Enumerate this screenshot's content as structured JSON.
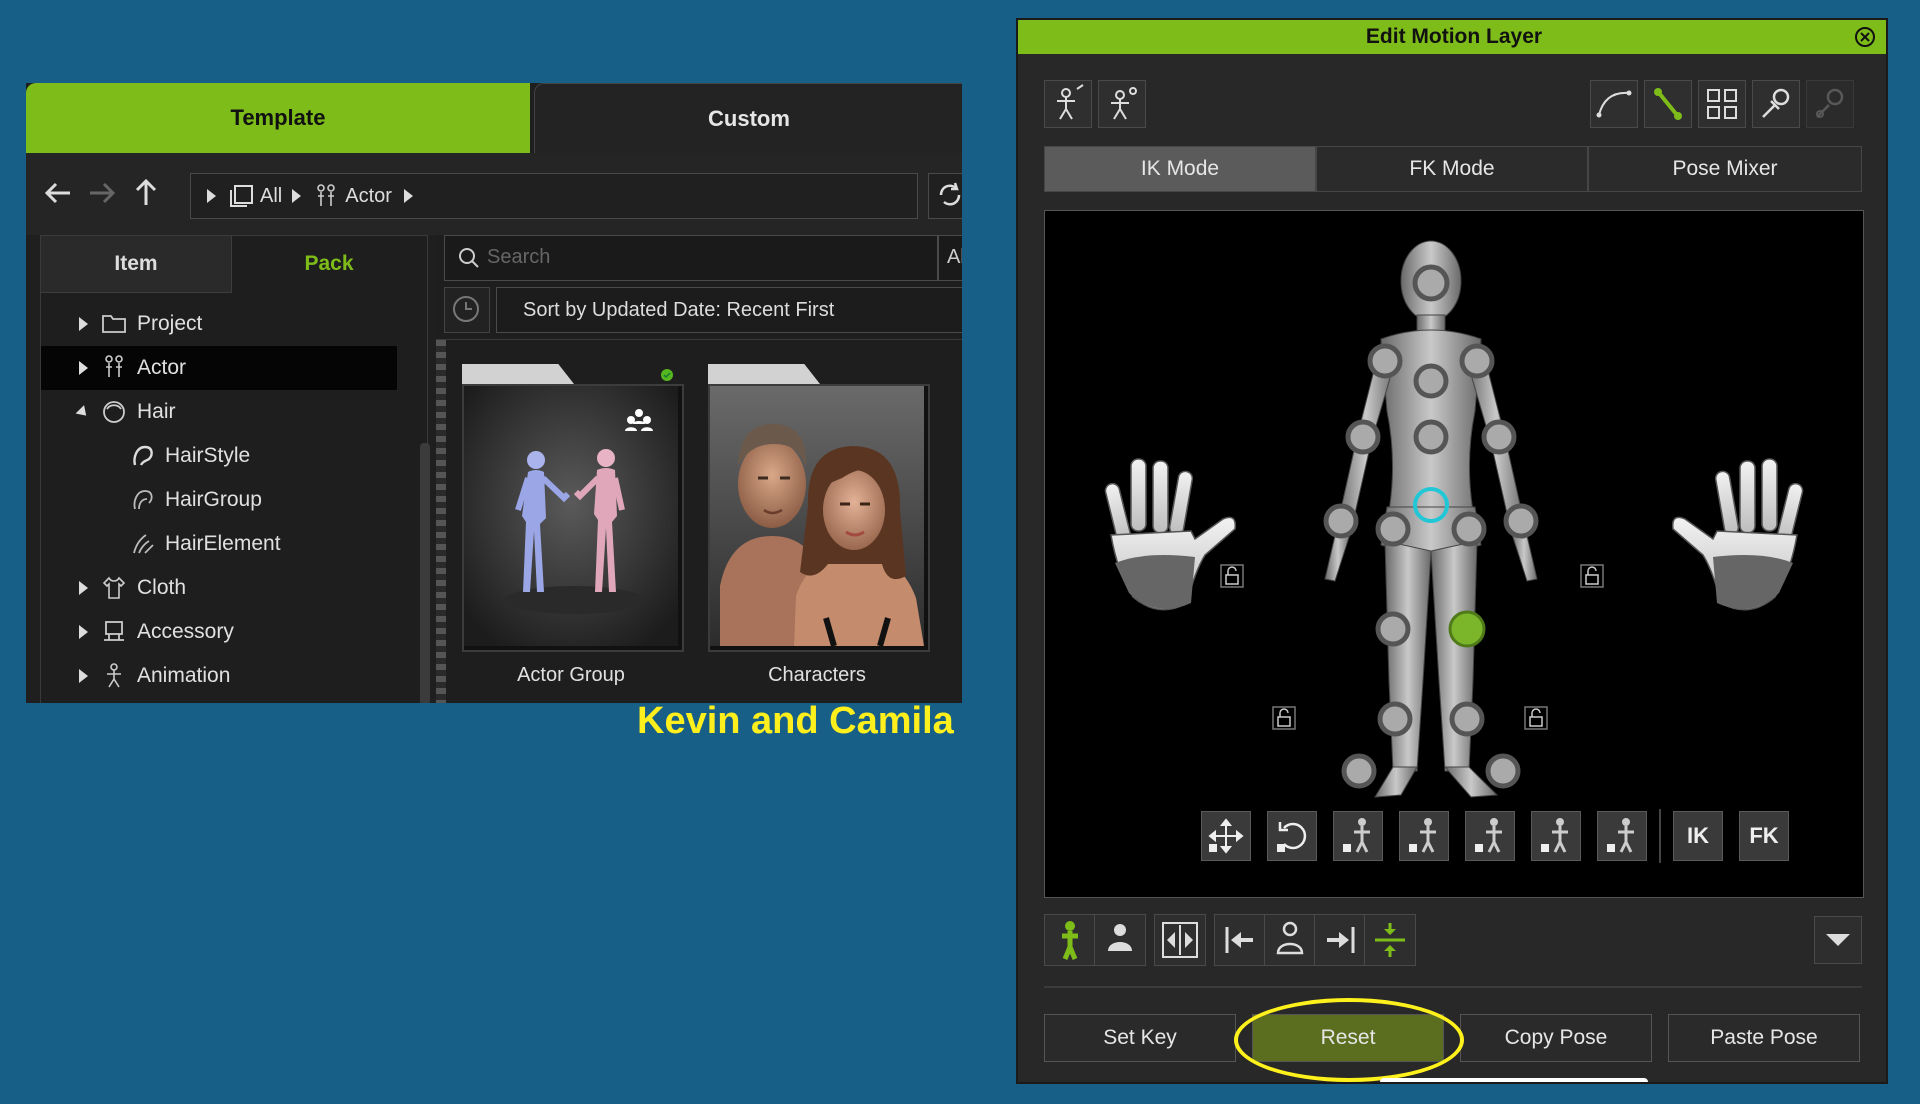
{
  "content_browser": {
    "tabs": {
      "template": "Template",
      "custom": "Custom"
    },
    "breadcrumb": {
      "all": "All",
      "actor": "Actor"
    },
    "subtabs": {
      "item": "Item",
      "pack": "Pack"
    },
    "tree": [
      {
        "label": "Project",
        "icon": "folder-icon",
        "state": "collapsed"
      },
      {
        "label": "Actor",
        "icon": "actor-icon",
        "state": "collapsed",
        "selected": true
      },
      {
        "label": "Hair",
        "icon": "hair-icon",
        "state": "expanded"
      },
      {
        "label": "HairStyle",
        "icon": "hairstyle-icon",
        "state": "child"
      },
      {
        "label": "HairGroup",
        "icon": "hairgroup-icon",
        "state": "child"
      },
      {
        "label": "HairElement",
        "icon": "hairelement-icon",
        "state": "child"
      },
      {
        "label": "Cloth",
        "icon": "cloth-icon",
        "state": "collapsed"
      },
      {
        "label": "Accessory",
        "icon": "accessory-icon",
        "state": "collapsed"
      },
      {
        "label": "Animation",
        "icon": "animation-icon",
        "state": "collapsed"
      }
    ],
    "search": {
      "placeholder": "Search",
      "extra": "Al"
    },
    "sort": {
      "label": "Sort by Updated Date: Recent First"
    },
    "cards": [
      {
        "label": "Actor Group",
        "icon": "group-icon"
      },
      {
        "label": "Characters"
      }
    ]
  },
  "overlay": {
    "caption": "Kevin and Camila"
  },
  "motion_layer": {
    "title": "Edit Motion Layer",
    "mode_tabs": [
      {
        "label": "IK Mode",
        "active": true
      },
      {
        "label": "FK Mode",
        "active": false
      },
      {
        "label": "Pose Mixer",
        "active": false
      }
    ],
    "viewport_tools": {
      "ik": "IK",
      "fk": "FK"
    },
    "actions": {
      "set_key": "Set Key",
      "reset": "Reset",
      "copy_pose": "Copy Pose",
      "paste_pose": "Paste Pose"
    },
    "colors": {
      "accent": "#7ebd19",
      "highlight": "#fff21c",
      "selected_joint": "#22c7d6",
      "active_joint": "#7ab52a"
    }
  }
}
